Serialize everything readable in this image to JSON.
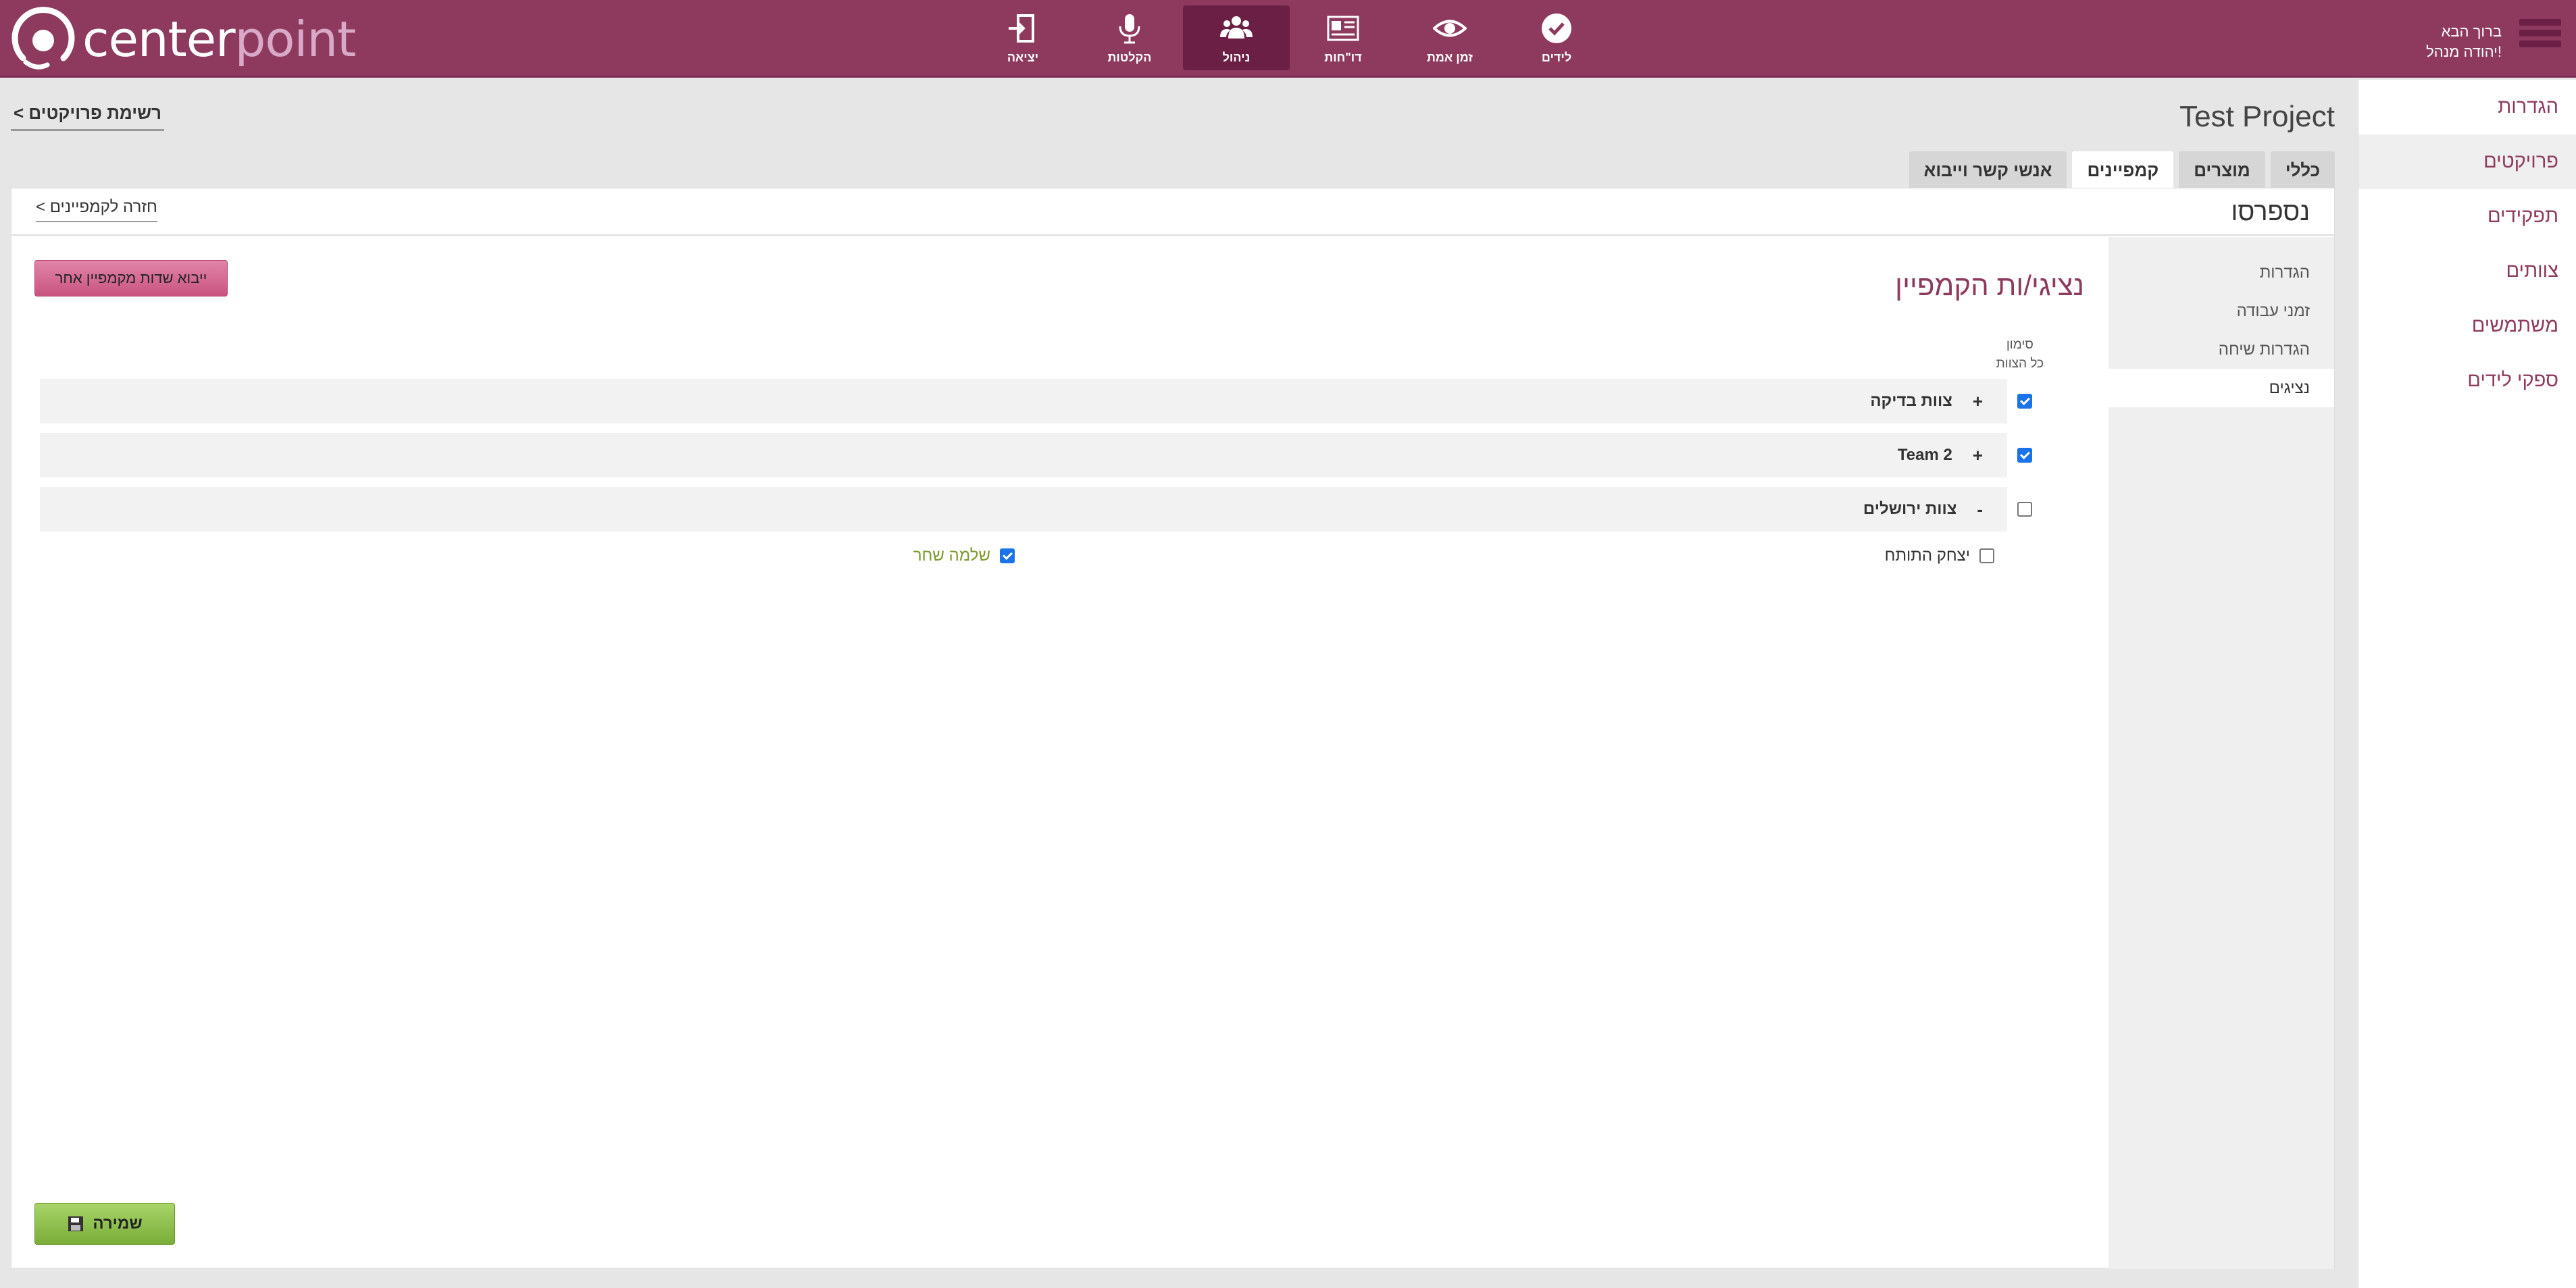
{
  "header": {
    "logo_text_a": "center",
    "logo_text_b": "point",
    "nav": [
      {
        "label": "לידים",
        "icon": "check-circle-icon"
      },
      {
        "label": "זמן אמת",
        "icon": "eye-icon"
      },
      {
        "label": "דו\"חות",
        "icon": "report-card-icon"
      },
      {
        "label": "ניהול",
        "icon": "users-icon"
      },
      {
        "label": "הקלטות",
        "icon": "microphone-icon"
      },
      {
        "label": "יציאה",
        "icon": "logout-icon"
      }
    ],
    "greeting": "ברוך הבא",
    "user_name": "יהודה מנהל!"
  },
  "sidebar": {
    "items": [
      {
        "label": "הגדרות"
      },
      {
        "label": "פרויקטים"
      },
      {
        "label": "תפקידים"
      },
      {
        "label": "צוותים"
      },
      {
        "label": "משתמשים"
      },
      {
        "label": "ספקי לידים"
      }
    ]
  },
  "main": {
    "project_title": "Test Project",
    "back_to_projects": "< רשימת פרויקטים",
    "tabs": [
      {
        "label": "כללי"
      },
      {
        "label": "מוצרים"
      },
      {
        "label": "קמפיינים"
      },
      {
        "label": "אנשי קשר וייבוא"
      }
    ],
    "campaign_name": "נספרסו",
    "back_to_campaigns": "< חזרה לקמפיינים",
    "inner_nav": [
      {
        "label": "הגדרות"
      },
      {
        "label": "זמני עבודה"
      },
      {
        "label": "הגדרות שיחה"
      },
      {
        "label": "נציגים"
      }
    ],
    "section_title": "נציגי/ות הקמפיין",
    "import_button": "ייבוא שדות מקמפיין אחר",
    "mark_all_line1": "סימון",
    "mark_all_line2": "כל הצוות",
    "teams": [
      {
        "name": "צוות בדיקה",
        "sign": "+",
        "checked": true
      },
      {
        "name": "Team 2",
        "sign": "+",
        "checked": true
      },
      {
        "name": "צוות ירושלים",
        "sign": "-",
        "checked": false
      }
    ],
    "members": [
      {
        "name": "יצחק התותח",
        "checked": false,
        "color": "#333333"
      },
      {
        "name": "שלמה שחר",
        "checked": true,
        "color": "#7a9a2a"
      }
    ],
    "save_button": "שמירה"
  },
  "colors": {
    "brand": "#8e3a5f",
    "brand_dark": "#6b1f44",
    "import_button": "#d3648f",
    "save_button": "#8cc04b"
  }
}
